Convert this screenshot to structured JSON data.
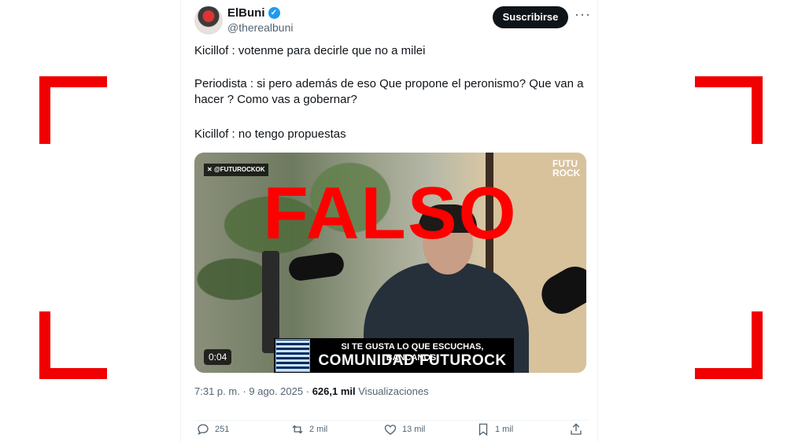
{
  "author": {
    "name": "ElBuni",
    "handle": "@therealbuni",
    "subscribe_label": "Suscribirse",
    "more_label": "···"
  },
  "tweet": {
    "line1": "Kicillof : votenme para decirle que no a milei",
    "line2": "Periodista : si pero además de eso  Que propone el peronismo? Que van a hacer ? Como vas a gobernar?",
    "line3": "Kicillof : no tengo propuestas"
  },
  "media": {
    "overlay_word": "FALSO",
    "source_tag": "@FUTUROCKOK",
    "logo": "FUTU ROCK",
    "banner_top": "SI TE GUSTA LO QUE ESCUCHAS, BANCANOS.",
    "banner_main": "COMUNIDAD FUTUROCK",
    "duration": "0:04"
  },
  "meta": {
    "time": "7:31 p. m.",
    "date": "9 ago. 2025",
    "separator": "·",
    "views_count": "626,1 mil",
    "views_label": "Visualizaciones"
  },
  "actions": {
    "replies": "251",
    "reposts": "2 mil",
    "likes": "13 mil",
    "bookmarks": "1 mil"
  },
  "colors": {
    "bracket": "#f00000",
    "falso_text": "#ff0000",
    "verified": "#1d9bf0"
  }
}
